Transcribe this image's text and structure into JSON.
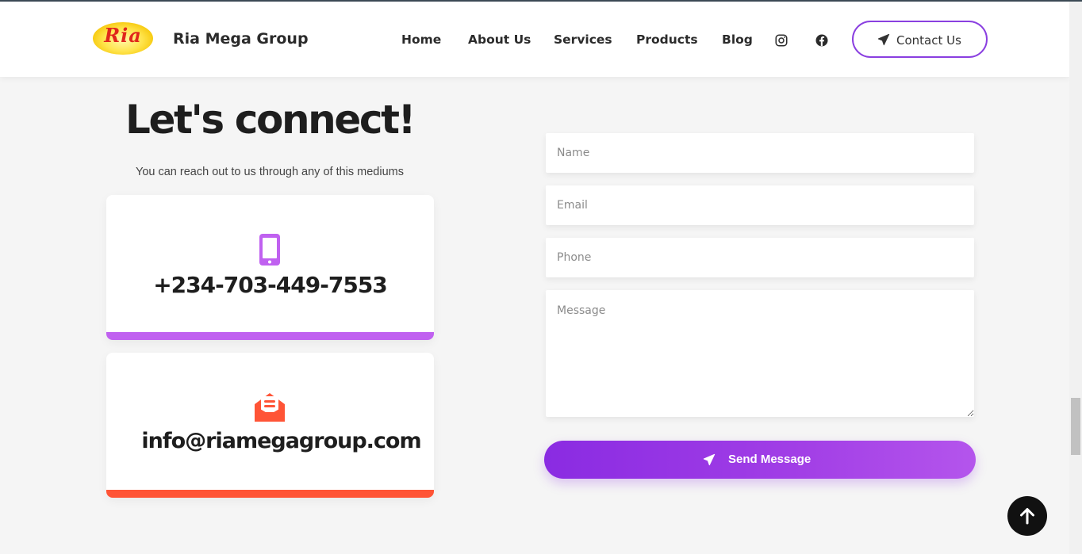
{
  "header": {
    "logo_text": "Ria",
    "brand": "Ria Mega Group",
    "nav": [
      "Home",
      "About Us",
      "Services",
      "Products",
      "Blog"
    ],
    "social_icons": [
      "instagram-icon",
      "facebook-icon"
    ],
    "contact_label": "Contact Us",
    "accent": "#8a3fe0"
  },
  "left": {
    "heading": "Let's connect!",
    "subheading": "You can reach out to us through any of this mediums",
    "phone": "+234-703-449-7553",
    "email": "info@riamegagroup.com",
    "phone_color": "#c061f0",
    "email_color": "#ff5436"
  },
  "form": {
    "name_placeholder": "Name",
    "email_placeholder": "Email",
    "phone_placeholder": "Phone",
    "message_placeholder": "Message",
    "submit_label": "Send Message"
  }
}
